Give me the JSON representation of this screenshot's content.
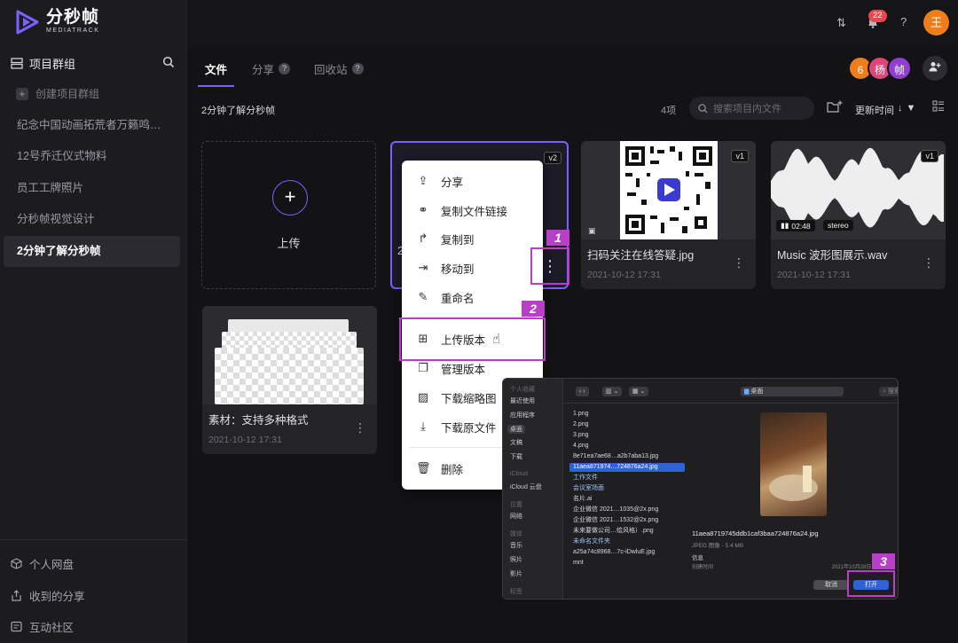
{
  "app": {
    "logo_title": "分秒帧",
    "logo_sub": "MEDIATRACK"
  },
  "sidebar": {
    "group_title": "项目群组",
    "new_group": "创建项目群组",
    "projects": [
      "纪念中国动画拓荒者万籁鸣…",
      "12号乔迁仪式物料",
      "员工工牌照片",
      "分秒帧视觉设计",
      "2分钟了解分秒帧"
    ],
    "active_index": 4,
    "bottom": [
      "个人网盘",
      "收到的分享",
      "互动社区"
    ]
  },
  "topbar": {
    "notif_count": "22",
    "user_initial": "王"
  },
  "tabs": [
    {
      "label": "文件"
    },
    {
      "label": "分享"
    },
    {
      "label": "回收站"
    }
  ],
  "members": {
    "count": "6",
    "a": "杨",
    "b": "帧"
  },
  "toolbar": {
    "breadcrumb": "2分钟了解分秒帧",
    "count": "4项",
    "search_placeholder": "搜索项目内文件",
    "sort_label": "更新时间"
  },
  "upload": {
    "label": "上传"
  },
  "files": [
    {
      "version": "v2",
      "name": "2",
      "date": ""
    },
    {
      "version": "v1",
      "name": "扫码关注在线答疑.jpg",
      "date": "2021-10-12 17:31"
    },
    {
      "version": "v1",
      "name": "Music 波形图展示.wav",
      "date": "2021-10-12 17:31",
      "duration": "02:48",
      "channel": "stereo"
    },
    {
      "name": "素材：支持多种格式",
      "date": "2021-10-12 17:31"
    }
  ],
  "context_menu": [
    "分享",
    "复制文件链接",
    "复制到",
    "移动到",
    "重命名",
    "上传版本",
    "管理版本",
    "下载缩略图",
    "下载原文件",
    "删除"
  ],
  "steps": [
    "1",
    "2",
    "3"
  ],
  "dialog": {
    "sidebar": [
      "个人收藏",
      "最近使用",
      "应用程序",
      "桌面",
      "文稿",
      "下载",
      "iCloud",
      "iCloud 云盘",
      "位置",
      "网络",
      "媒体",
      "音乐",
      "照片",
      "影片",
      "标签"
    ],
    "location": "桌面",
    "search": "搜索",
    "files": [
      "1.png",
      "2.png",
      "3.png",
      "4.png",
      "8e71ea7ae68…a2b7aba13.jpg",
      "11aea871974…724876a24.jpg",
      "工作文件",
      "会议室场面",
      "名片.ai",
      "企业微信 2021…1035@2x.png",
      "企业微信 2021…1532@2x.png",
      "未来要做公司…绘风格）.png",
      "未命名文件夹",
      "a25a74c8968…7c-iDwluE.jpg",
      "mnt"
    ],
    "selected_index": 5,
    "folder_indices": [
      6,
      7,
      12
    ],
    "preview_name": "11aea8719745ddb1caf3baa724876a24.jpg",
    "preview_meta": "JPEG 图像 - 5.4 MB",
    "info": "信息",
    "created_label": "创建时间",
    "created_value": "2021年10月28日 星期四",
    "cancel": "取消",
    "open": "打开"
  },
  "colors": {
    "accent": "#7b61ff",
    "highlight": "#b93fc9",
    "badge": "#e5484d",
    "avatar": "#ef7d1a"
  }
}
